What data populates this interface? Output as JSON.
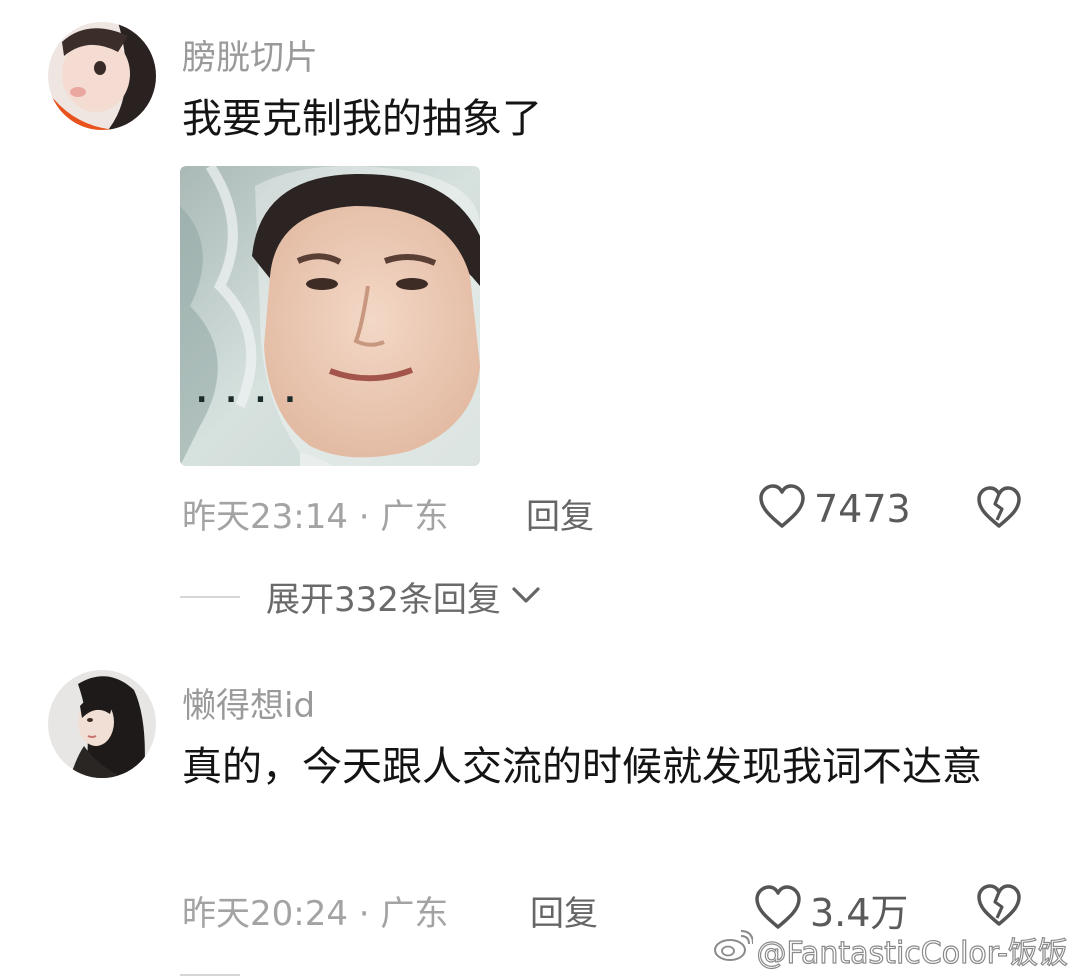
{
  "comments": [
    {
      "username": "膀胱切片",
      "text": "我要克制我的抽象了",
      "meta": "昨天23:14 · 广东",
      "reply_label": "回复",
      "like_count": "7473",
      "has_sticker": true,
      "sticker_overlay_text": "....",
      "expand_label": "展开332条回复"
    },
    {
      "username": "懒得想id",
      "text": "真的，今天跟人交流的时候就发现我词不达意",
      "meta": "昨天20:24 · 广东",
      "reply_label": "回复",
      "like_count": "3.4万"
    }
  ],
  "watermark": {
    "text": "@FantasticColor-饭饭",
    "icon": "weibo-logo-icon"
  },
  "colors": {
    "meta_gray": "#a3a3a3",
    "username_gray": "#9a9a9a",
    "text_dark": "#141414",
    "icon_gray": "#555555"
  }
}
